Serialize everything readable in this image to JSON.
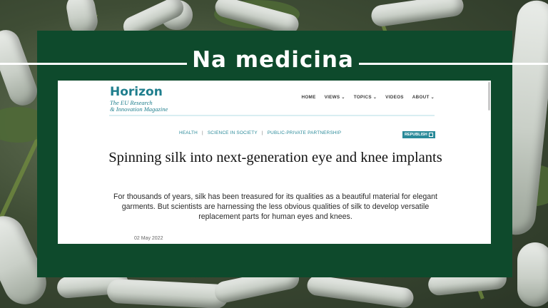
{
  "overlay": {
    "title": "Na medicina"
  },
  "site": {
    "logo_main": "Horizon",
    "logo_sub_line1": "The EU Research",
    "logo_sub_line2": "& Innovation Magazine",
    "nav": [
      {
        "label": "HOME",
        "dropdown": false
      },
      {
        "label": "VIEWS",
        "dropdown": true
      },
      {
        "label": "TOPICS",
        "dropdown": true
      },
      {
        "label": "VIDEOS",
        "dropdown": false
      },
      {
        "label": "ABOUT",
        "dropdown": true
      }
    ]
  },
  "article": {
    "tags": [
      "HEALTH",
      "SCIENCE IN SOCIETY",
      "PUBLIC-PRIVATE PARTNERSHIP"
    ],
    "republish_label": "REPUBLISH",
    "headline": "Spinning silk into next-generation eye and knee implants",
    "lede": "For thousands of years, silk has been treasured for its qualities as a beautiful material for elegant garments. But scientists are harnessing the less obvious qualities of silk to develop versatile replacement parts for human eyes and knees.",
    "date": "02 May 2022"
  },
  "colors": {
    "panel": "#0e4a2c",
    "brand": "#1f7e8d",
    "link": "#2a8a99"
  }
}
